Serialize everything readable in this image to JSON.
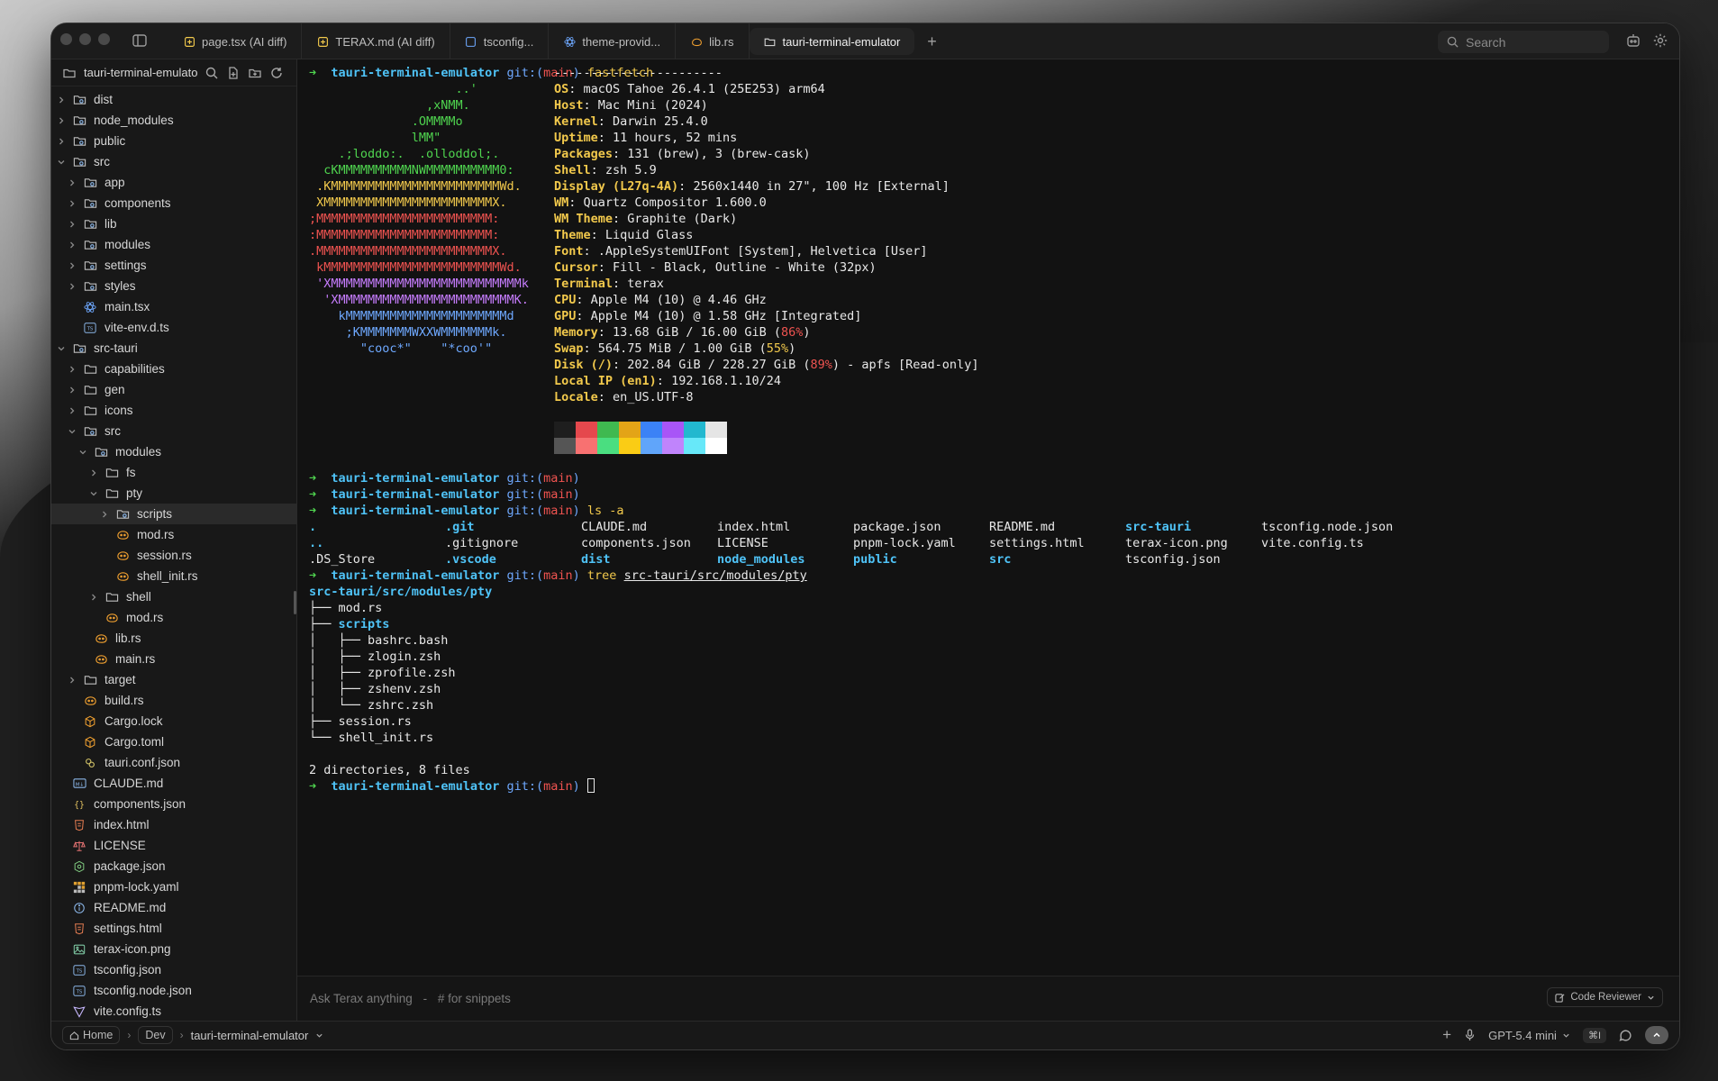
{
  "tabs": [
    {
      "label": "page.tsx (AI diff)",
      "icon": "ai-diff-icon",
      "icon_color": "#f2c94c"
    },
    {
      "label": "TERAX.md (AI diff)",
      "icon": "ai-diff-icon",
      "icon_color": "#f2c94c"
    },
    {
      "label": "tsconfig...",
      "icon": "typescript-config-icon",
      "icon_color": "#6ea8fe"
    },
    {
      "label": "theme-provid...",
      "icon": "react-icon",
      "icon_color": "#6ea8fe"
    },
    {
      "label": "lib.rs",
      "icon": "rust-icon",
      "icon_color": "#f0a030"
    },
    {
      "label": "tauri-terminal-emulator",
      "icon": "folder-icon",
      "icon_color": "#cfcfcf",
      "active": true
    }
  ],
  "search": {
    "placeholder": "Search"
  },
  "sidebar": {
    "title": "tauri-terminal-emulator",
    "items": [
      {
        "label": "dist",
        "depth": 0,
        "type": "folder-special",
        "chev": "right"
      },
      {
        "label": "node_modules",
        "depth": 0,
        "type": "folder-special",
        "chev": "right"
      },
      {
        "label": "public",
        "depth": 0,
        "type": "folder-special",
        "chev": "right"
      },
      {
        "label": "src",
        "depth": 0,
        "type": "folder-special",
        "chev": "down"
      },
      {
        "label": "app",
        "depth": 1,
        "type": "folder-special",
        "chev": "right"
      },
      {
        "label": "components",
        "depth": 1,
        "type": "folder-special",
        "chev": "right"
      },
      {
        "label": "lib",
        "depth": 1,
        "type": "folder-special",
        "chev": "right"
      },
      {
        "label": "modules",
        "depth": 1,
        "type": "folder-special",
        "chev": "right"
      },
      {
        "label": "settings",
        "depth": 1,
        "type": "folder-special",
        "chev": "right"
      },
      {
        "label": "styles",
        "depth": 1,
        "type": "folder-special",
        "chev": "right"
      },
      {
        "label": "main.tsx",
        "depth": 1,
        "type": "react"
      },
      {
        "label": "vite-env.d.ts",
        "depth": 1,
        "type": "ts"
      },
      {
        "label": "src-tauri",
        "depth": 0,
        "type": "folder-special",
        "chev": "down"
      },
      {
        "label": "capabilities",
        "depth": 1,
        "type": "folder",
        "chev": "right"
      },
      {
        "label": "gen",
        "depth": 1,
        "type": "folder",
        "chev": "right"
      },
      {
        "label": "icons",
        "depth": 1,
        "type": "folder",
        "chev": "right"
      },
      {
        "label": "src",
        "depth": 1,
        "type": "folder-special",
        "chev": "down"
      },
      {
        "label": "modules",
        "depth": 2,
        "type": "folder-special",
        "chev": "down"
      },
      {
        "label": "fs",
        "depth": 3,
        "type": "folder",
        "chev": "right"
      },
      {
        "label": "pty",
        "depth": 3,
        "type": "folder",
        "chev": "down"
      },
      {
        "label": "scripts",
        "depth": 4,
        "type": "folder-special",
        "chev": "right",
        "selected": true
      },
      {
        "label": "mod.rs",
        "depth": 4,
        "type": "rust"
      },
      {
        "label": "session.rs",
        "depth": 4,
        "type": "rust"
      },
      {
        "label": "shell_init.rs",
        "depth": 4,
        "type": "rust"
      },
      {
        "label": "shell",
        "depth": 3,
        "type": "folder",
        "chev": "right"
      },
      {
        "label": "mod.rs",
        "depth": 3,
        "type": "rust"
      },
      {
        "label": "lib.rs",
        "depth": 2,
        "type": "rust"
      },
      {
        "label": "main.rs",
        "depth": 2,
        "type": "rust"
      },
      {
        "label": "target",
        "depth": 1,
        "type": "folder",
        "chev": "right"
      },
      {
        "label": "build.rs",
        "depth": 1,
        "type": "rust"
      },
      {
        "label": "Cargo.lock",
        "depth": 1,
        "type": "cargo"
      },
      {
        "label": "Cargo.toml",
        "depth": 1,
        "type": "cargo"
      },
      {
        "label": "tauri.conf.json",
        "depth": 1,
        "type": "tauri"
      },
      {
        "label": "CLAUDE.md",
        "depth": 0,
        "type": "md"
      },
      {
        "label": "components.json",
        "depth": 0,
        "type": "json"
      },
      {
        "label": "index.html",
        "depth": 0,
        "type": "html"
      },
      {
        "label": "LICENSE",
        "depth": 0,
        "type": "license"
      },
      {
        "label": "package.json",
        "depth": 0,
        "type": "npm"
      },
      {
        "label": "pnpm-lock.yaml",
        "depth": 0,
        "type": "pnpm"
      },
      {
        "label": "README.md",
        "depth": 0,
        "type": "info"
      },
      {
        "label": "settings.html",
        "depth": 0,
        "type": "html"
      },
      {
        "label": "terax-icon.png",
        "depth": 0,
        "type": "image"
      },
      {
        "label": "tsconfig.json",
        "depth": 0,
        "type": "ts"
      },
      {
        "label": "tsconfig.node.json",
        "depth": 0,
        "type": "ts"
      },
      {
        "label": "vite.config.ts",
        "depth": 0,
        "type": "vite"
      }
    ]
  },
  "terminal": {
    "prompt_arrow": "➜",
    "repo": "tauri-terminal-emulator",
    "git_prefix": "git:(",
    "branch": "main",
    "git_suffix": ")",
    "cmd_fastfetch": "fastfetch",
    "ff_rule": "-----------------------",
    "logo": [
      {
        "text": "                    ..'",
        "color": "g"
      },
      {
        "text": "                ,xNMM.",
        "color": "g"
      },
      {
        "text": "              .OMMMMo",
        "color": "g"
      },
      {
        "text": "              lMM\"",
        "color": "g"
      },
      {
        "text": "    .;loddo:.  .olloddol;.",
        "color": "g"
      },
      {
        "text": "  cKMMMMMMMMMMNWMMMMMMMMMM0:",
        "color": "g"
      },
      {
        "text": " .KMMMMMMMMMMMMMMMMMMMMMMMWd.",
        "color": "y"
      },
      {
        "text": " XMMMMMMMMMMMMMMMMMMMMMMMX.",
        "color": "y"
      },
      {
        "text": ";MMMMMMMMMMMMMMMMMMMMMMMM:",
        "color": "r"
      },
      {
        "text": ":MMMMMMMMMMMMMMMMMMMMMMMM:",
        "color": "r"
      },
      {
        "text": ".MMMMMMMMMMMMMMMMMMMMMMMMX.",
        "color": "r"
      },
      {
        "text": " kMMMMMMMMMMMMMMMMMMMMMMMMWd.",
        "color": "r"
      },
      {
        "text": " 'XMMMMMMMMMMMMMMMMMMMMMMMMMMk",
        "color": "m"
      },
      {
        "text": "  'XMMMMMMMMMMMMMMMMMMMMMMMMK.",
        "color": "m"
      },
      {
        "text": "    kMMMMMMMMMMMMMMMMMMMMMMd",
        "color": "b"
      },
      {
        "text": "     ;KMMMMMMMWXXWMMMMMMMk.",
        "color": "b"
      },
      {
        "text": "       \"cooc*\"    \"*coo'\"",
        "color": "b"
      }
    ],
    "info": [
      {
        "k": "OS",
        "v": "macOS Tahoe 26.4.1 (25E253) arm64"
      },
      {
        "k": "Host",
        "v": "Mac Mini (2024)"
      },
      {
        "k": "Kernel",
        "v": "Darwin 25.4.0"
      },
      {
        "k": "Uptime",
        "v": "11 hours, 52 mins"
      },
      {
        "k": "Packages",
        "v": "131 (brew), 3 (brew-cask)"
      },
      {
        "k": "Shell",
        "v": "zsh 5.9"
      },
      {
        "k": "Display (L27q-4A)",
        "v": "2560x1440 in 27\", 100 Hz [External]"
      },
      {
        "k": "WM",
        "v": "Quartz Compositor 1.600.0"
      },
      {
        "k": "WM Theme",
        "v": "Graphite (Dark)"
      },
      {
        "k": "Theme",
        "v": "Liquid Glass"
      },
      {
        "k": "Font",
        "v": ".AppleSystemUIFont [System], Helvetica [User]"
      },
      {
        "k": "Cursor",
        "v": "Fill - Black, Outline - White (32px)"
      },
      {
        "k": "Terminal",
        "v": "terax"
      },
      {
        "k": "CPU",
        "v": "Apple M4 (10) @ 4.46 GHz"
      },
      {
        "k": "GPU",
        "v": "Apple M4 (10) @ 1.58 GHz [Integrated]"
      },
      {
        "k": "Memory",
        "v": "13.68 GiB / 16.00 GiB (",
        "pct": "86%",
        "pct_color": "r",
        "tail": ")"
      },
      {
        "k": "Swap",
        "v": "564.75 MiB / 1.00 GiB (",
        "pct": "55%",
        "pct_color": "y",
        "tail": ")"
      },
      {
        "k": "Disk (/)",
        "v": "202.84 GiB / 228.27 GiB (",
        "pct": "89%",
        "pct_color": "r",
        "tail": ") - apfs [Read-only]"
      },
      {
        "k": "Local IP (en1)",
        "v": "192.168.1.10/24"
      },
      {
        "k": "Locale",
        "v": "en_US.UTF-8"
      }
    ],
    "palette_top": [
      "#1e1e1e",
      "#e5484d",
      "#3fb950",
      "#e3a417",
      "#3b82f6",
      "#a855f7",
      "#22b8cf",
      "#e5e5e5"
    ],
    "palette_bottom": [
      "#555555",
      "#f87171",
      "#4ade80",
      "#facc15",
      "#60a5fa",
      "#c084fc",
      "#67e8f9",
      "#ffffff"
    ],
    "cmd_ls": "ls -a",
    "ls_rows": [
      [
        {
          "t": ".",
          "d": true
        },
        {
          "t": ".git",
          "d": true
        },
        {
          "t": "CLAUDE.md"
        },
        {
          "t": "index.html"
        },
        {
          "t": "package.json"
        },
        {
          "t": "README.md"
        },
        {
          "t": "src-tauri",
          "d": true
        },
        {
          "t": "tsconfig.node.json"
        }
      ],
      [
        {
          "t": "..",
          "d": true
        },
        {
          "t": ".gitignore"
        },
        {
          "t": "components.json"
        },
        {
          "t": "LICENSE"
        },
        {
          "t": "pnpm-lock.yaml"
        },
        {
          "t": "settings.html"
        },
        {
          "t": "terax-icon.png"
        },
        {
          "t": "vite.config.ts"
        }
      ],
      [
        {
          "t": ".DS_Store"
        },
        {
          "t": ".vscode",
          "d": true
        },
        {
          "t": "dist",
          "d": true
        },
        {
          "t": "node_modules",
          "d": true
        },
        {
          "t": "public",
          "d": true
        },
        {
          "t": "src",
          "d": true
        },
        {
          "t": "tsconfig.json"
        },
        {
          "t": ""
        }
      ]
    ],
    "cmd_tree": "tree",
    "tree_arg": "src-tauri/src/modules/pty",
    "tree_root": "src-tauri/src/modules/pty",
    "tree_lines": [
      {
        "prefix": "├── ",
        "name": "mod.rs"
      },
      {
        "prefix": "├── ",
        "name": "scripts",
        "d": true
      },
      {
        "prefix": "│   ├── ",
        "name": "bashrc.bash"
      },
      {
        "prefix": "│   ├── ",
        "name": "zlogin.zsh"
      },
      {
        "prefix": "│   ├── ",
        "name": "zprofile.zsh"
      },
      {
        "prefix": "│   ├── ",
        "name": "zshenv.zsh"
      },
      {
        "prefix": "│   └── ",
        "name": "zshrc.zsh"
      },
      {
        "prefix": "├── ",
        "name": "session.rs"
      },
      {
        "prefix": "└── ",
        "name": "shell_init.rs"
      }
    ],
    "tree_summary": "2 directories, 8 files"
  },
  "ask": {
    "placeholder": "Ask Terax anything",
    "snippets_hint": "# for snippets",
    "separator": "-",
    "reviewer_label": "Code Reviewer"
  },
  "status": {
    "home": "Home",
    "dev": "Dev",
    "project": "tauri-terminal-emulator",
    "model": "GPT-5.4 mini",
    "shortcut": "⌘I"
  }
}
